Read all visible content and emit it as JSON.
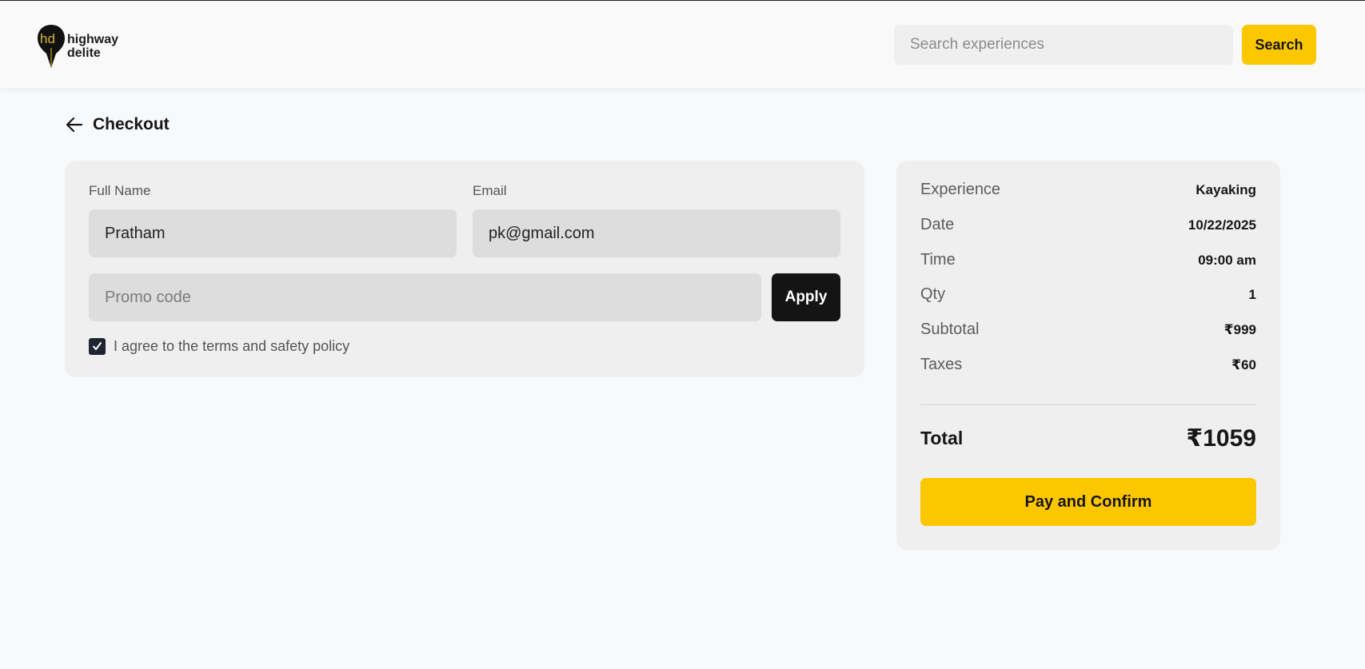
{
  "brand": {
    "logo_icon": "map-pin-hd-logo",
    "name_line1": "highway",
    "name_line2": "delite",
    "accent_color": "#fdc700"
  },
  "search": {
    "placeholder": "Search experiences",
    "button_label": "Search"
  },
  "page": {
    "back_icon": "arrow-left-icon",
    "title": "Checkout"
  },
  "form": {
    "full_name_label": "Full Name",
    "full_name_value": "Pratham",
    "email_label": "Email",
    "email_value": "pk@gmail.com",
    "promo_placeholder": "Promo code",
    "promo_value": "",
    "apply_label": "Apply",
    "terms_checked": true,
    "terms_label": "I agree to the terms and safety policy"
  },
  "summary": {
    "rows": [
      {
        "key": "Experience",
        "value": "Kayaking"
      },
      {
        "key": "Date",
        "value": "10/22/2025"
      },
      {
        "key": "Time",
        "value": "09:00 am"
      },
      {
        "key": "Qty",
        "value": "1"
      },
      {
        "key": "Subtotal",
        "value": "₹999"
      },
      {
        "key": "Taxes",
        "value": "₹60"
      }
    ],
    "total_label": "Total",
    "total_value": "₹1059",
    "pay_button_label": "Pay and Confirm"
  }
}
